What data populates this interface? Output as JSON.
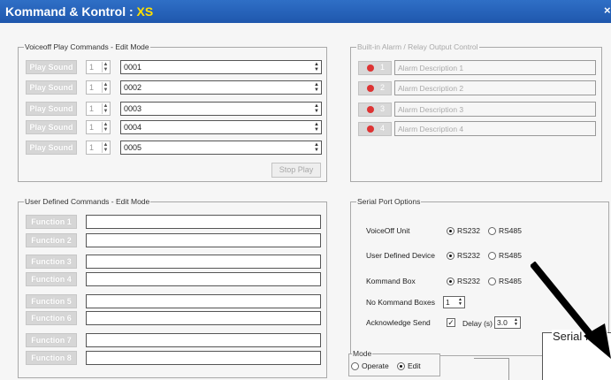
{
  "window": {
    "title_prefix": "Kommand & Kontrol : ",
    "title_accent": "XS",
    "close_glyph": "×"
  },
  "voiceoff": {
    "legend": "Voiceoff Play Commands - Edit Mode",
    "rows": [
      {
        "button": "Play Sound",
        "spin": "1",
        "value": "0001"
      },
      {
        "button": "Play Sound",
        "spin": "1",
        "value": "0002"
      },
      {
        "button": "Play Sound",
        "spin": "1",
        "value": "0003"
      },
      {
        "button": "Play Sound",
        "spin": "1",
        "value": "0004"
      },
      {
        "button": "Play Sound",
        "spin": "1",
        "value": "0005"
      }
    ],
    "stop_label": "Stop Play"
  },
  "alarm": {
    "legend": "Built-in Alarm / Relay Output Control",
    "rows": [
      {
        "num": "1",
        "desc": "Alarm Description 1"
      },
      {
        "num": "2",
        "desc": "Alarm Description 2"
      },
      {
        "num": "3",
        "desc": "Alarm Description 3"
      },
      {
        "num": "4",
        "desc": "Alarm Description 4"
      }
    ]
  },
  "user_defined": {
    "legend": "User Defined Commands - Edit Mode",
    "functions": [
      "Function 1",
      "Function 2",
      "Function 3",
      "Function 4",
      "Function 5",
      "Function 6",
      "Function 7",
      "Function 8"
    ]
  },
  "serial": {
    "legend": "Serial Port Options",
    "rs232": "RS232",
    "rs485": "RS485",
    "voiceoff_unit": "VoiceOff Unit",
    "user_defined_device": "User Defined Device",
    "kommand_box": "Kommand Box",
    "no_kommand_boxes": "No Kommand Boxes",
    "no_kommand_boxes_value": "1",
    "ack_send": "Acknowledge Send",
    "delay_label": "Delay (s)",
    "delay_value": "3.0"
  },
  "mode": {
    "legend": "Mode",
    "operate": "Operate",
    "edit": "Edit"
  },
  "inset": {
    "caption": "Serial Port"
  },
  "colors": {
    "title_bar": "#1f57ad",
    "accent": "#ffe000",
    "alarm_dot": "#dd3333"
  }
}
